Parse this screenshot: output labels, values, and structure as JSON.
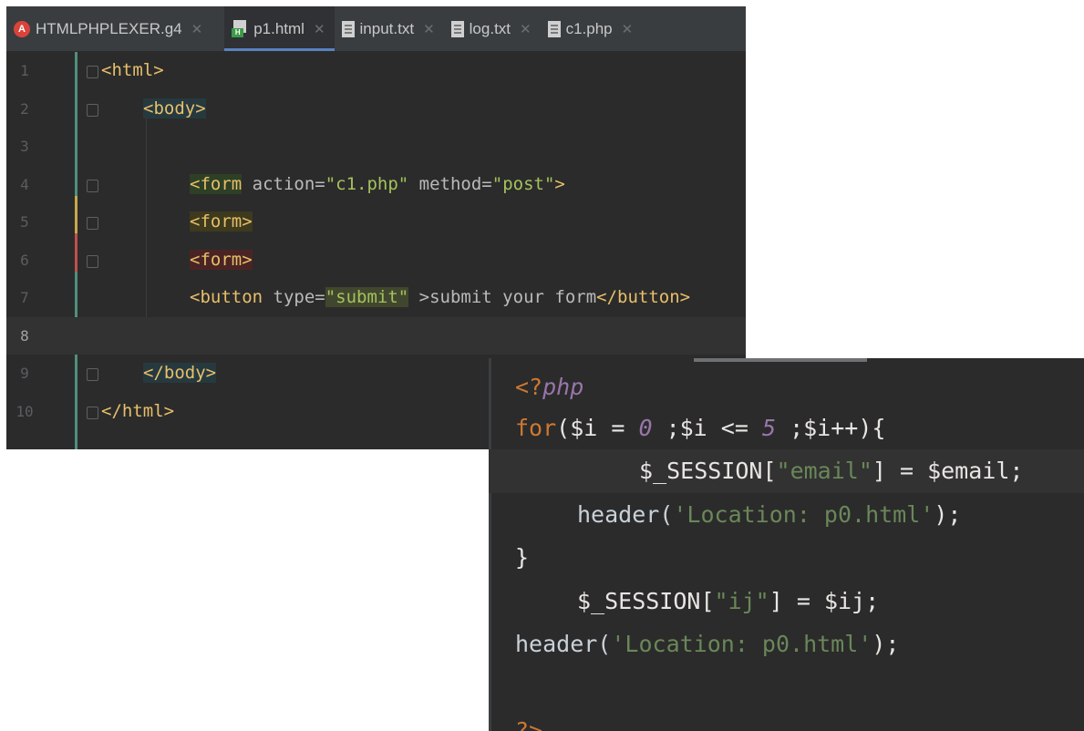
{
  "editor1": {
    "tabs": [
      {
        "label": "HTMLPHPLEXER.g4",
        "icon": "antlr-file-icon"
      },
      {
        "label": "p1.html",
        "icon": "html-file-icon"
      },
      {
        "label": "input.txt",
        "icon": "text-file-icon"
      },
      {
        "label": "log.txt",
        "icon": "text-file-icon"
      },
      {
        "label": "c1.php",
        "icon": "text-file-icon"
      }
    ],
    "line_numbers": [
      "1",
      "2",
      "3",
      "4",
      "5",
      "6",
      "7",
      "8",
      "9",
      "10"
    ],
    "code": {
      "l1": "<html>",
      "l2": "<body>",
      "l4_tag_open": "<form",
      "l4_attr1": " action=",
      "l4_val1": "\"c1.php\"",
      "l4_attr2": " method=",
      "l4_val2": "\"post\"",
      "l4_close": ">",
      "l5": "<form>",
      "l6": "<form>",
      "l7_tag_open": "<button",
      "l7_attr": " type=",
      "l7_val": "\"submit\"",
      "l7_text": " >submit your form",
      "l7_tag_close": "</button>",
      "l9": "</body>",
      "l10": "</html>"
    }
  },
  "editor2": {
    "code": {
      "l1_open": "<?",
      "l1_php": "php",
      "l2_for": "for",
      "l2_a": "($i = ",
      "l2_zero": "0",
      "l2_b": " ;$i <= ",
      "l2_five": "5",
      "l2_c": " ;$i++){",
      "l3_a": "$_SESSION[",
      "l3_str": "\"email\"",
      "l3_b": "] = $email;",
      "l4_a": "header(",
      "l4_str": "'Location: p0.html'",
      "l4_b": ");",
      "l5": "}",
      "l6_a": "$_SESSION[",
      "l6_str": "\"ij\"",
      "l6_b": "] = $ij;",
      "l7_a": "header(",
      "l7_str": "'Location: p0.html'",
      "l7_b": ");",
      "l9": "?>"
    }
  }
}
